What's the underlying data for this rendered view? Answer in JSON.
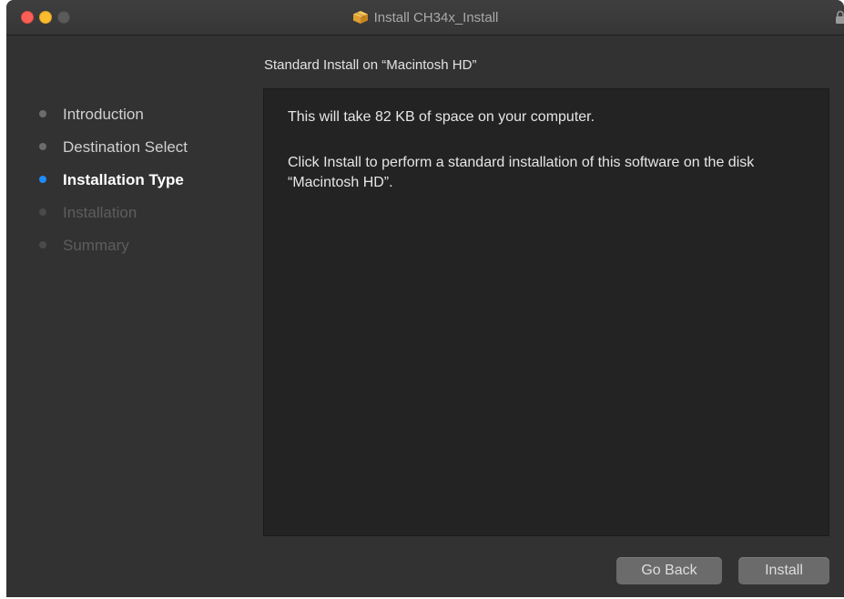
{
  "window": {
    "title": "Install CH34x_Install",
    "title_icon": "package-icon",
    "lock_icon": "lock-icon",
    "traffic_lights": {
      "close_color": "#fc5f57",
      "minimize_color": "#fdbc2e",
      "zoom_color": "#5a5a5a"
    }
  },
  "sidebar": {
    "steps": [
      {
        "label": "Introduction",
        "state": "done"
      },
      {
        "label": "Destination Select",
        "state": "done"
      },
      {
        "label": "Installation Type",
        "state": "active"
      },
      {
        "label": "Installation",
        "state": "pending"
      },
      {
        "label": "Summary",
        "state": "pending"
      }
    ],
    "active_color": "#1f8bff"
  },
  "main": {
    "section_title": "Standard Install on “Macintosh HD”",
    "paragraphs": [
      "This will take 82 KB of space on your computer.",
      "Click Install to perform a standard installation of this software on the disk “Macintosh HD”."
    ]
  },
  "buttons": {
    "go_back": "Go Back",
    "install": "Install"
  }
}
